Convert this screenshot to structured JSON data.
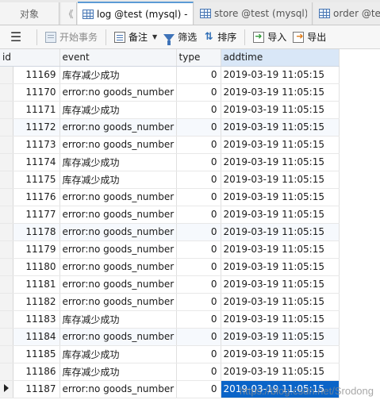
{
  "tabs": {
    "objects": "对象",
    "log": "log @test (mysql) -...",
    "store": "store @test (mysql)...",
    "order": "order @te"
  },
  "toolbar": {
    "begin_transaction": "开始事务",
    "note": "备注",
    "filter": "筛选",
    "sort": "排序",
    "import": "导入",
    "export": "导出"
  },
  "icons": {
    "menu": "menu-icon",
    "table": "table-grid-icon",
    "transaction": "transaction-icon",
    "note": "note-icon",
    "filter": "filter-icon",
    "sort": "sort-icon",
    "import": "import-icon",
    "export": "export-icon"
  },
  "colors": {
    "selection": "#0a64c8",
    "header_active": "#d9e7f7",
    "tab_accent": "#5b9bd5"
  },
  "grid": {
    "columns": [
      "id",
      "event",
      "type",
      "addtime"
    ],
    "rows": [
      {
        "id": "11169",
        "event": "库存减少成功",
        "type": "0",
        "addtime": "2019-03-19 11:05:15"
      },
      {
        "id": "11170",
        "event": "error:no goods_number",
        "type": "0",
        "addtime": "2019-03-19 11:05:15"
      },
      {
        "id": "11171",
        "event": "库存减少成功",
        "type": "0",
        "addtime": "2019-03-19 11:05:15"
      },
      {
        "id": "11172",
        "event": "error:no goods_number",
        "type": "0",
        "addtime": "2019-03-19 11:05:15"
      },
      {
        "id": "11173",
        "event": "error:no goods_number",
        "type": "0",
        "addtime": "2019-03-19 11:05:15"
      },
      {
        "id": "11174",
        "event": "库存减少成功",
        "type": "0",
        "addtime": "2019-03-19 11:05:15"
      },
      {
        "id": "11175",
        "event": "库存减少成功",
        "type": "0",
        "addtime": "2019-03-19 11:05:15"
      },
      {
        "id": "11176",
        "event": "error:no goods_number",
        "type": "0",
        "addtime": "2019-03-19 11:05:15"
      },
      {
        "id": "11177",
        "event": "error:no goods_number",
        "type": "0",
        "addtime": "2019-03-19 11:05:15"
      },
      {
        "id": "11178",
        "event": "error:no goods_number",
        "type": "0",
        "addtime": "2019-03-19 11:05:15"
      },
      {
        "id": "11179",
        "event": "error:no goods_number",
        "type": "0",
        "addtime": "2019-03-19 11:05:15"
      },
      {
        "id": "11180",
        "event": "error:no goods_number",
        "type": "0",
        "addtime": "2019-03-19 11:05:15"
      },
      {
        "id": "11181",
        "event": "error:no goods_number",
        "type": "0",
        "addtime": "2019-03-19 11:05:15"
      },
      {
        "id": "11182",
        "event": "error:no goods_number",
        "type": "0",
        "addtime": "2019-03-19 11:05:15"
      },
      {
        "id": "11183",
        "event": "库存减少成功",
        "type": "0",
        "addtime": "2019-03-19 11:05:15"
      },
      {
        "id": "11184",
        "event": "error:no goods_number",
        "type": "0",
        "addtime": "2019-03-19 11:05:15"
      },
      {
        "id": "11185",
        "event": "库存减少成功",
        "type": "0",
        "addtime": "2019-03-19 11:05:15"
      },
      {
        "id": "11186",
        "event": "库存减少成功",
        "type": "0",
        "addtime": "2019-03-19 11:05:15"
      },
      {
        "id": "11187",
        "event": "error:no goods_number",
        "type": "0",
        "addtime": "2019-03-19 11:05:15"
      }
    ]
  },
  "watermark": "https://blog.csdn.net/Srodong"
}
